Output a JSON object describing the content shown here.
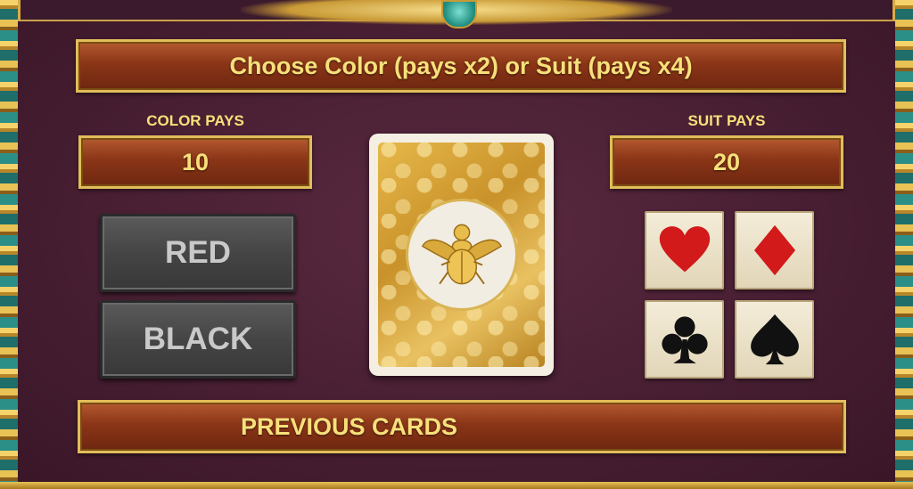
{
  "title": "Choose Color (pays x2) or Suit (pays x4)",
  "color_pays": {
    "label": "COLOR PAYS",
    "value": "10"
  },
  "suit_pays": {
    "label": "SUIT PAYS",
    "value": "20"
  },
  "color_buttons": {
    "red": "RED",
    "black": "BLACK"
  },
  "card": {
    "back_icon": "scarab-icon"
  },
  "suits": [
    {
      "name": "hearts",
      "icon": "heart-icon",
      "color": "#d21a1a"
    },
    {
      "name": "diamonds",
      "icon": "diamond-icon",
      "color": "#d21a1a"
    },
    {
      "name": "clubs",
      "icon": "club-icon",
      "color": "#111111"
    },
    {
      "name": "spades",
      "icon": "spade-icon",
      "color": "#111111"
    }
  ],
  "previous_cards": "PREVIOUS CARDS",
  "colors": {
    "bar_text": "#f7e07a",
    "bar_fill": "#8a3517",
    "gold_border": "#e2bd5a",
    "panel": "#4a2034"
  }
}
